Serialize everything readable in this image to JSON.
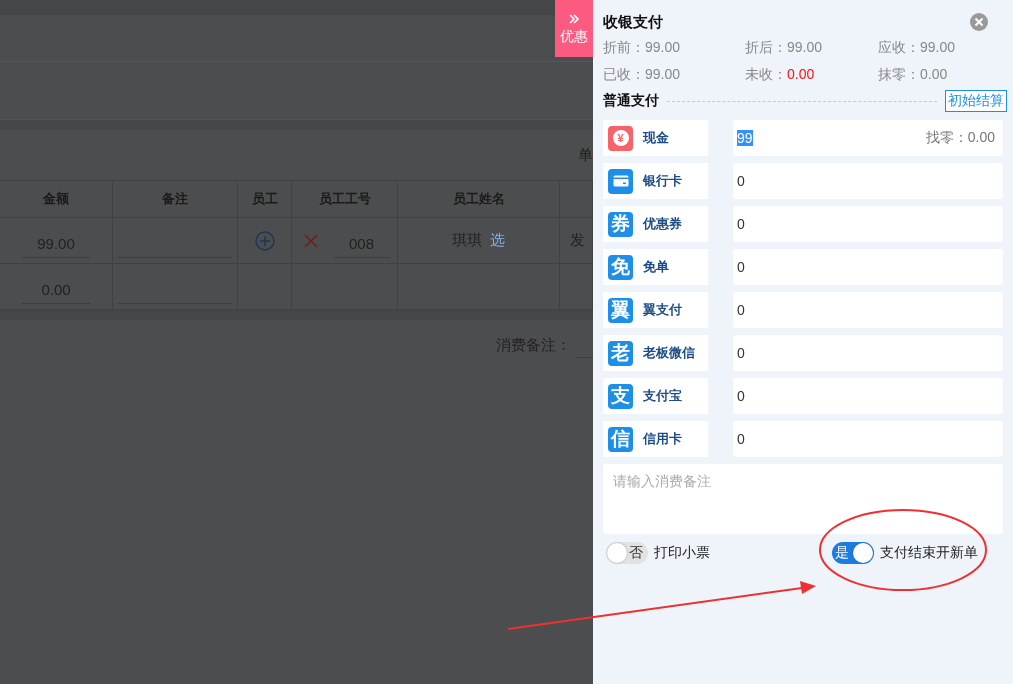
{
  "background_page": {
    "cut_label": "单",
    "table": {
      "columns": [
        "金额",
        "备注",
        "员工",
        "员工工号",
        "员工姓名"
      ],
      "rows": [
        {
          "amount": "99.00",
          "note": "",
          "staff_add": true,
          "staff_remove": true,
          "staff_id": "008",
          "staff_name": "琪琪",
          "pick_link": "选",
          "column_6": "发"
        },
        {
          "amount": "0.00",
          "note": ""
        }
      ]
    },
    "remark_label": "消费备注："
  },
  "discount_tab": {
    "label": "优惠"
  },
  "panel": {
    "title": "收银支付",
    "summary": [
      {
        "label": "折前：",
        "value": "99.00",
        "alert": false
      },
      {
        "label": "折后：",
        "value": "99.00",
        "alert": false
      },
      {
        "label": "应收：",
        "value": "99.00",
        "alert": false
      },
      {
        "label": "已收：",
        "value": "99.00",
        "alert": false
      },
      {
        "label": "未收：",
        "value": "0.00",
        "alert": true
      },
      {
        "label": "抹零：",
        "value": "0.00",
        "alert": false
      }
    ],
    "section_title": "普通支付",
    "reset_button": "初始结算",
    "methods": [
      {
        "icon": {
          "kind": "coin",
          "char": "¥"
        },
        "label": "现金",
        "value": "99",
        "text_selected": true,
        "change": "找零：0.00"
      },
      {
        "icon": {
          "kind": "card"
        },
        "label": "银行卡",
        "value": "0",
        "text_selected": false
      },
      {
        "icon": {
          "kind": "char",
          "char": "券"
        },
        "label": "优惠券",
        "value": "0",
        "text_selected": false
      },
      {
        "icon": {
          "kind": "char",
          "char": "免"
        },
        "label": "免单",
        "value": "0",
        "text_selected": false
      },
      {
        "icon": {
          "kind": "char",
          "char": "翼"
        },
        "label": "翼支付",
        "value": "0",
        "text_selected": false
      },
      {
        "icon": {
          "kind": "char",
          "char": "老"
        },
        "label": "老板微信",
        "value": "0",
        "text_selected": false
      },
      {
        "icon": {
          "kind": "char",
          "char": "支"
        },
        "label": "支付宝",
        "value": "0",
        "text_selected": false
      },
      {
        "icon": {
          "kind": "char",
          "char": "信"
        },
        "label": "信用卡",
        "value": "0",
        "text_selected": false
      }
    ],
    "note": {
      "placeholder": "请输入消费备注"
    },
    "toggles": [
      {
        "label": "打印小票",
        "on": false,
        "state_text": "否"
      },
      {
        "label": "支付结束开新单",
        "on": true,
        "state_text": "是"
      }
    ]
  }
}
